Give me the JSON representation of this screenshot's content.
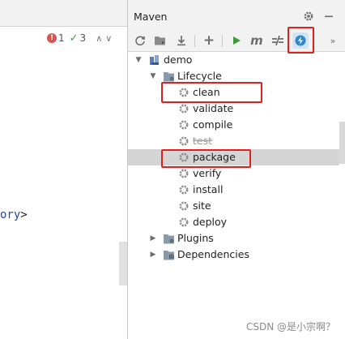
{
  "editor": {
    "error_count": "1",
    "ok_count": "3",
    "code_fragment_keyword": "ory",
    "code_fragment_punct": ">"
  },
  "maven": {
    "title": "Maven",
    "toolbar": {
      "reload": "reload-all-icon",
      "add_sources": "generate-sources-icon",
      "download": "download-icon",
      "add": "+",
      "run": "run-icon",
      "execute_goal": "m",
      "skip_tests": "toggle-skip-tests-icon",
      "offline": "offline-mode-icon",
      "more": "»"
    },
    "tree": {
      "project": "demo",
      "lifecycle": "Lifecycle",
      "goals": [
        "clean",
        "validate",
        "compile",
        "test",
        "package",
        "verify",
        "install",
        "site",
        "deploy"
      ],
      "plugins": "Plugins",
      "dependencies": "Dependencies"
    },
    "selected_goal": "package",
    "struck_goal": "test"
  },
  "colors": {
    "annotation": "#e0201c",
    "selection": "#d5d5d5",
    "run_green": "#3c9a3c",
    "offline_blue": "#2f86c8"
  },
  "watermark": "CSDN @是小宗啊？"
}
